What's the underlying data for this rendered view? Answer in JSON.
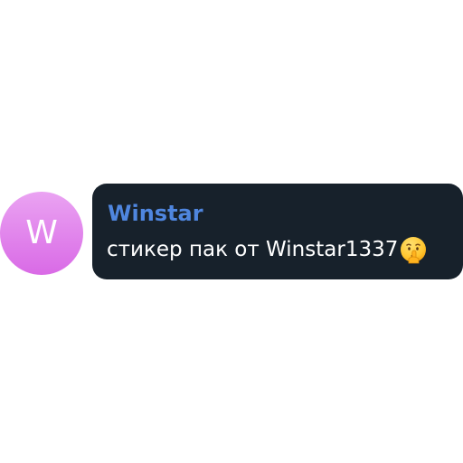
{
  "message": {
    "avatar_initial": "W",
    "sender_name": "Winstar",
    "text": "стикер пак от Winstar1337",
    "emoji_icon": "shushing-face-icon"
  },
  "colors": {
    "avatar_gradient_top": "#eaa3f2",
    "avatar_gradient_bottom": "#d96ae6",
    "bubble_background": "#17212b",
    "sender_name": "#4f86df",
    "message_text": "#ffffff",
    "page_background": "#ffffff"
  }
}
